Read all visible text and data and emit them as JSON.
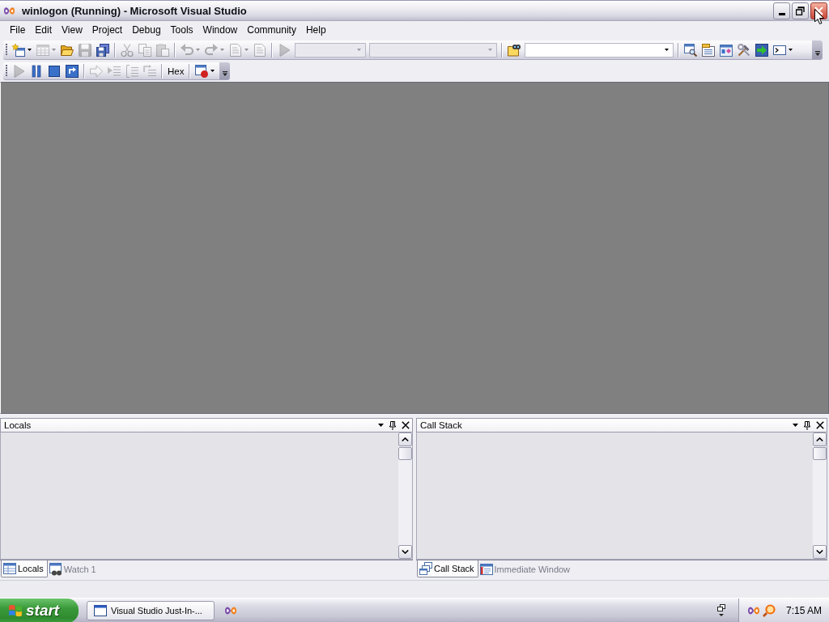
{
  "window": {
    "title": "winlogon (Running) - Microsoft Visual Studio",
    "buttons": [
      {
        "kind": "minimize",
        "hovered": false
      },
      {
        "kind": "restore",
        "hovered": false
      },
      {
        "kind": "close",
        "hovered": true
      }
    ]
  },
  "menu": [
    "File",
    "Edit",
    "View",
    "Project",
    "Debug",
    "Tools",
    "Window",
    "Community",
    "Help"
  ],
  "toolbars": [
    {
      "items": [
        {
          "kind": "button",
          "disabled": false,
          "dropdown": true
        },
        {
          "kind": "button",
          "disabled": true,
          "dropdown": true
        },
        {
          "kind": "button",
          "disabled": false,
          "dropdown": false
        },
        {
          "kind": "button",
          "disabled": true,
          "dropdown": false
        },
        {
          "kind": "button",
          "disabled": false,
          "dropdown": false
        },
        {
          "kind": "separator"
        },
        {
          "kind": "button",
          "disabled": true,
          "dropdown": false
        },
        {
          "kind": "button",
          "disabled": true,
          "dropdown": false
        },
        {
          "kind": "button",
          "disabled": true,
          "dropdown": false
        },
        {
          "kind": "separator"
        },
        {
          "kind": "button",
          "disabled": true,
          "dropdown": true
        },
        {
          "kind": "button",
          "disabled": true,
          "dropdown": true
        },
        {
          "kind": "button",
          "disabled": true,
          "dropdown": true
        },
        {
          "kind": "button",
          "disabled": true,
          "dropdown": false
        },
        {
          "kind": "separator"
        },
        {
          "kind": "button",
          "disabled": true,
          "dropdown": false
        },
        {
          "kind": "combo",
          "disabled": true
        },
        {
          "kind": "combo",
          "disabled": true
        },
        {
          "kind": "separator"
        },
        {
          "kind": "button",
          "disabled": false,
          "dropdown": false
        },
        {
          "kind": "combo",
          "disabled": false
        },
        {
          "kind": "separator"
        },
        {
          "kind": "button",
          "disabled": false,
          "dropdown": false
        },
        {
          "kind": "button",
          "disabled": false,
          "dropdown": false
        },
        {
          "kind": "button",
          "disabled": false,
          "dropdown": false
        },
        {
          "kind": "button",
          "disabled": false,
          "dropdown": false
        },
        {
          "kind": "button",
          "disabled": false,
          "dropdown": false
        },
        {
          "kind": "button",
          "disabled": false,
          "dropdown": true
        }
      ]
    },
    {
      "items": [
        {
          "kind": "button",
          "disabled": true,
          "dropdown": false
        },
        {
          "kind": "button",
          "disabled": false,
          "dropdown": false
        },
        {
          "kind": "button",
          "disabled": false,
          "dropdown": false
        },
        {
          "kind": "button",
          "disabled": false,
          "dropdown": false
        },
        {
          "kind": "separator"
        },
        {
          "kind": "button",
          "disabled": true,
          "dropdown": false
        },
        {
          "kind": "button",
          "disabled": true,
          "dropdown": false
        },
        {
          "kind": "button",
          "disabled": true,
          "dropdown": false
        },
        {
          "kind": "button",
          "disabled": true,
          "dropdown": false
        },
        {
          "kind": "separator"
        },
        {
          "kind": "text",
          "label": "Hex"
        },
        {
          "kind": "separator"
        },
        {
          "kind": "button",
          "disabled": false,
          "dropdown": true
        }
      ]
    }
  ],
  "panels": [
    {
      "title": "Locals",
      "tabs": [
        {
          "label": "Locals",
          "selected": true
        },
        {
          "label": "Watch 1",
          "selected": false
        }
      ]
    },
    {
      "title": "Call Stack",
      "tabs": [
        {
          "label": "Call Stack",
          "selected": true
        },
        {
          "label": "Immediate Window",
          "selected": false
        }
      ]
    }
  ],
  "taskbar": {
    "start": "start",
    "tasks": [
      {
        "label": "Visual Studio Just-In-...",
        "selected": false
      }
    ],
    "clock": "7:15 AM"
  }
}
